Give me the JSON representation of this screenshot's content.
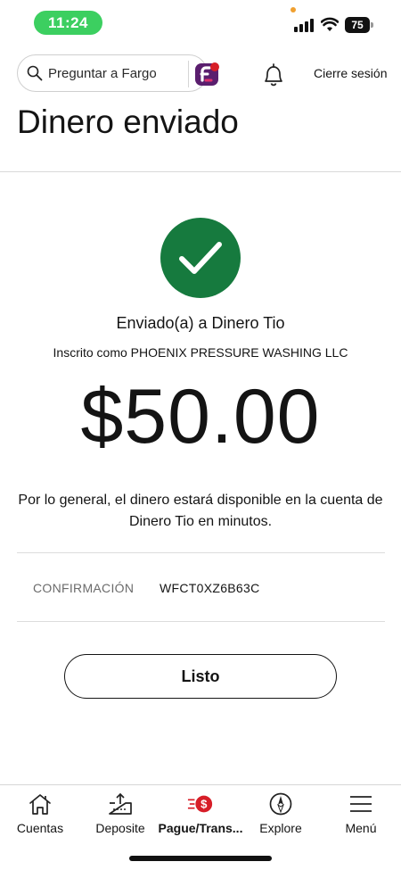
{
  "status_bar": {
    "time": "11:24",
    "battery": "75"
  },
  "header": {
    "search_placeholder": "Preguntar a Fargo",
    "logout_label": "Cierre sesión"
  },
  "page_title": "Dinero enviado",
  "confirmation": {
    "sent_to": "Enviado(a) a Dinero Tio",
    "registered_as": "Inscrito como PHOENIX PRESSURE WASHING LLC",
    "amount": "$50.00",
    "availability_note": "Por lo general, el dinero estará disponible en la cuenta de Dinero Tio en minutos.",
    "confirmation_label": "CONFIRMACIÓN",
    "confirmation_number": "WFCT0XZ6B63C",
    "done_label": "Listo"
  },
  "bottom_nav": {
    "items": [
      {
        "label": "Cuentas",
        "icon": "home-icon"
      },
      {
        "label": "Deposite",
        "icon": "deposit-icon"
      },
      {
        "label": "Pague/Trans...",
        "icon": "pay-transfer-icon"
      },
      {
        "label": "Explore",
        "icon": "compass-icon"
      },
      {
        "label": "Menú",
        "icon": "menu-icon"
      }
    ]
  },
  "colors": {
    "success_green": "#167a3e",
    "brand_red": "#d71e28",
    "fargo_purple": "#5a1e6e",
    "status_green": "#3ccf60"
  }
}
